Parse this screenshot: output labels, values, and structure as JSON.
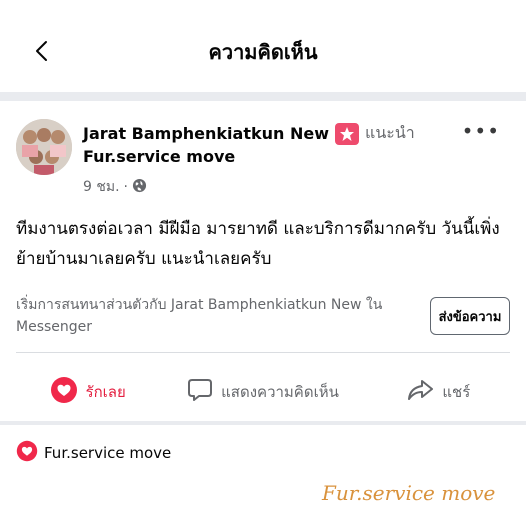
{
  "header": {
    "title": "ความคิดเห็น",
    "back_icon": "chevron-left-icon"
  },
  "post": {
    "author": "Jarat Bamphenkiatkun New",
    "badge_icon": "star-icon",
    "recommend_label": "แนะนำ",
    "page_name": "Fur.service move",
    "time": "9 ชม.",
    "separator": "·",
    "privacy_icon": "globe-icon",
    "more_icon": "more-dots-icon",
    "more_label": "•••",
    "body_line1": "ทีมงานตรงต่อเวลา มีฝีมือ มารยาทดี และบริการดีมากครับ วันนี้เพิ่ง",
    "body_line2": "ย้ายบ้านมาเลยครับ แนะนำเลยครับ",
    "messenger_prompt": "เริ่มการสนทนาส่วนตัวกับ Jarat Bamphenkiatkun New ใน Messenger",
    "send_message_label": "ส่งข้อความ"
  },
  "actions": {
    "love_label": "รักเลย",
    "comment_label": "แสดงความคิดเห็น",
    "share_label": "แชร์"
  },
  "reactions": {
    "name": "Fur.service move"
  },
  "watermark": "Fur.service move",
  "colors": {
    "love": "#e41e3f",
    "badge": "#ee4b6d",
    "watermark": "#d9923c"
  }
}
